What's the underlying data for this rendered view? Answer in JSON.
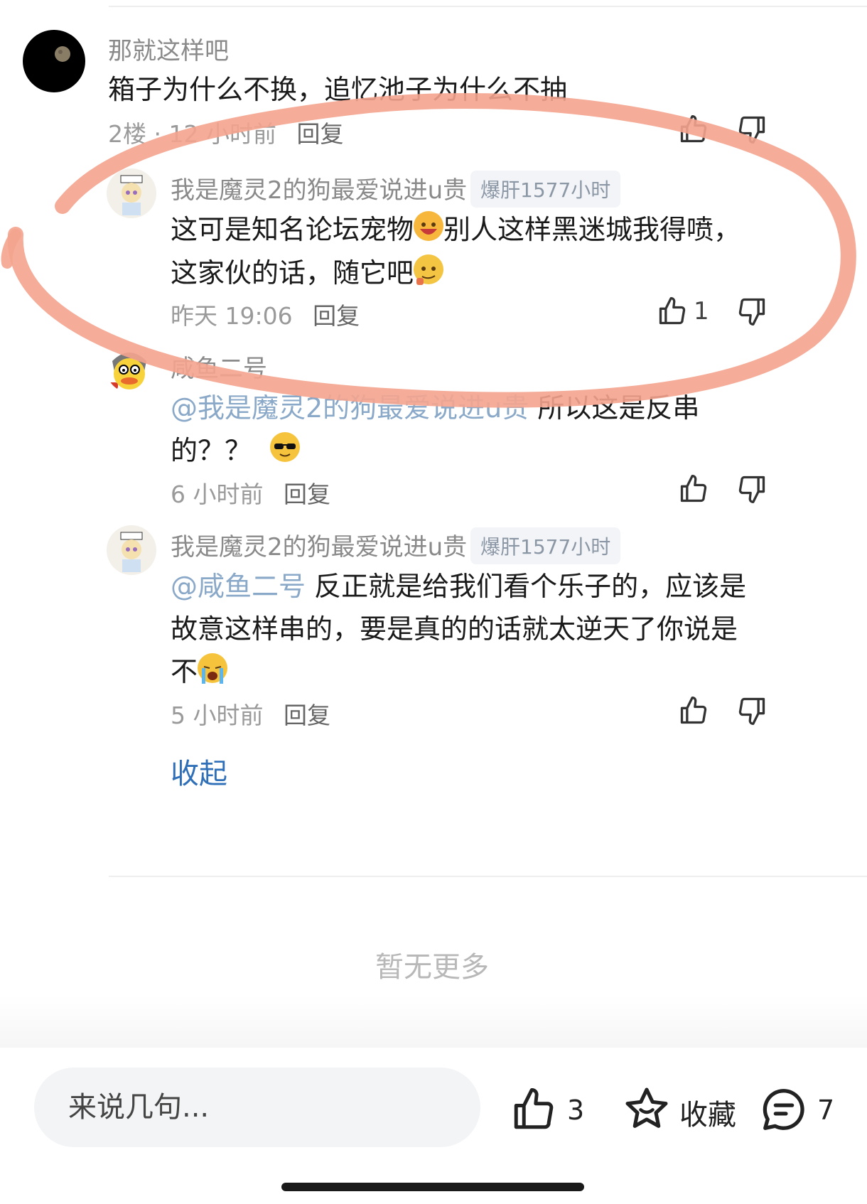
{
  "comments": [
    {
      "name": "那就这样吧",
      "text": "箱子为什么不换，追忆池子为什么不抽",
      "floor": "2楼",
      "time": "12 小时前",
      "reply": "回复"
    },
    {
      "name": "我是魔灵2的狗最爱说进u贵",
      "badge": "爆肝1577小时",
      "line1a": "这可是知名论坛宠物",
      "line1b": "别人这样黑迷城我得喷，",
      "line2": "这家伙的话，随它吧",
      "time": "昨天 19:06",
      "reply": "回复",
      "likes": "1"
    },
    {
      "name": "咸鱼二号",
      "mention": "@我是魔灵2的狗最爱说进u贵",
      "line1": " 所以这是反串",
      "line2": "的？？",
      "time": "6 小时前",
      "reply": "回复"
    },
    {
      "name": "我是魔灵2的狗最爱说进u贵",
      "badge": "爆肝1577小时",
      "mention": "@咸鱼二号",
      "line1": " 反正就是给我们看个乐子的，应该是",
      "line2": "故意这样串的，要是真的的话就太逆天了你说是",
      "line3": "不",
      "time": "5 小时前",
      "reply": "回复"
    }
  ],
  "collapse_label": "收起",
  "no_more": "暂无更多",
  "bottom": {
    "input_placeholder": "来说几句...",
    "like_count": "3",
    "favorite_label": "收藏",
    "comment_count": "7"
  },
  "colors": {
    "annotation_stroke": "#f4a48e",
    "link_blue": "#2f6fb8"
  }
}
